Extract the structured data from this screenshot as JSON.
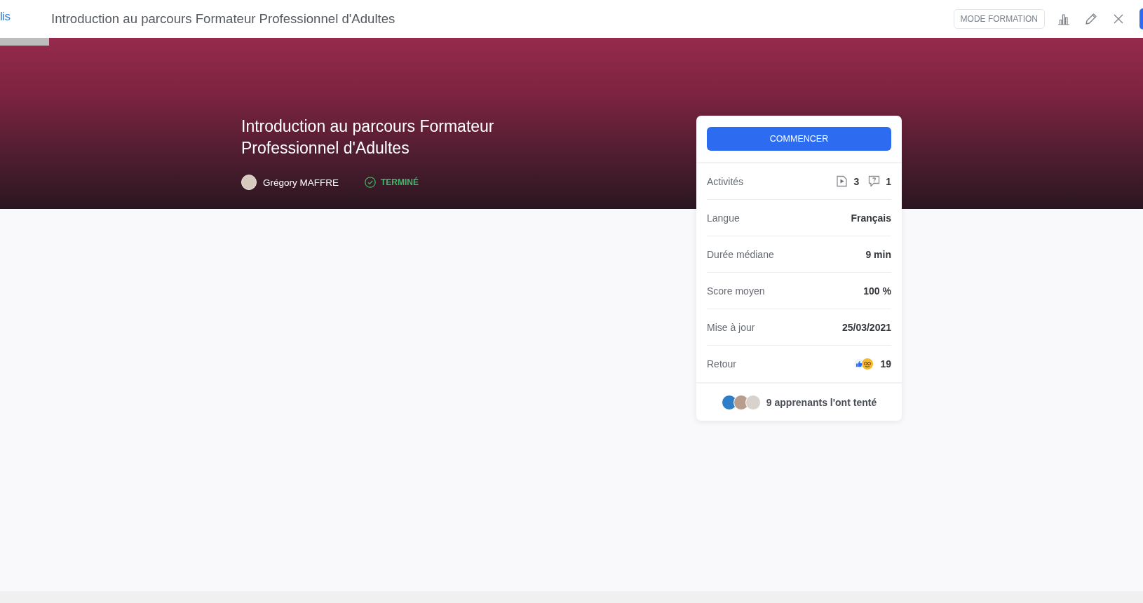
{
  "logo": {
    "text": "lis"
  },
  "header": {
    "title": "Introduction au parcours Formateur Professionnel d'Adultes",
    "mode_button": "MODE FORMATION"
  },
  "course": {
    "title": "Introduction au parcours Formateur Professionnel d'Adultes",
    "author": "Grégory MAFFRE",
    "status": {
      "label": "TERMINÉ",
      "completed": true
    }
  },
  "card": {
    "start_button": "COMMENCER",
    "rows": [
      {
        "kind": "activities",
        "label": "Activités",
        "counts": [
          {
            "kind": "video",
            "count": "3"
          },
          {
            "kind": "quiz",
            "count": "1"
          }
        ]
      },
      {
        "kind": "text",
        "label": "Langue",
        "value": "Français"
      },
      {
        "kind": "text",
        "label": "Durée médiane",
        "value": "9 min"
      },
      {
        "kind": "text",
        "label": "Score moyen",
        "value": "100 %"
      },
      {
        "kind": "text",
        "label": "Mise à jour",
        "value": "25/03/2021"
      },
      {
        "kind": "feedback",
        "label": "Retour",
        "value": "19"
      }
    ],
    "learners": {
      "text": "9 apprenants l'ont tenté"
    }
  }
}
